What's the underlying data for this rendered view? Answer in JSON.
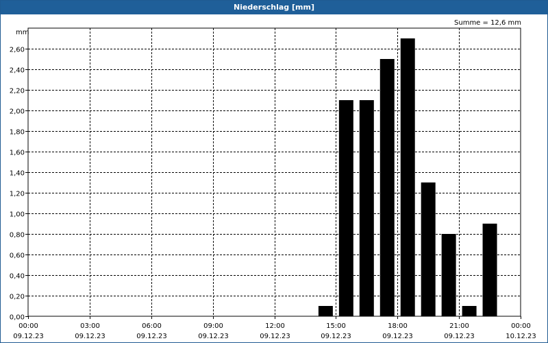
{
  "title": "Niederschlag [mm]",
  "summary": "Summe = 12,6 mm",
  "chart_data": {
    "type": "bar",
    "title": "Niederschlag [mm]",
    "ylabel": "mm",
    "ylim": [
      0,
      2.8
    ],
    "yticks": [
      "0,00",
      "0,20",
      "0,40",
      "0,60",
      "0,80",
      "1,00",
      "1,20",
      "1,40",
      "1,60",
      "1,80",
      "2,00",
      "2,20",
      "2,40",
      "2,60"
    ],
    "x_range_hours": [
      0,
      24
    ],
    "x_ticks": [
      {
        "hour": 0,
        "time": "00:00",
        "date": "09.12.23"
      },
      {
        "hour": 3,
        "time": "03:00",
        "date": "09.12.23"
      },
      {
        "hour": 6,
        "time": "06:00",
        "date": "09.12.23"
      },
      {
        "hour": 9,
        "time": "09:00",
        "date": "09.12.23"
      },
      {
        "hour": 12,
        "time": "12:00",
        "date": "09.12.23"
      },
      {
        "hour": 15,
        "time": "15:00",
        "date": "09.12.23"
      },
      {
        "hour": 18,
        "time": "18:00",
        "date": "09.12.23"
      },
      {
        "hour": 21,
        "time": "21:00",
        "date": "09.12.23"
      },
      {
        "hour": 24,
        "time": "00:00",
        "date": "10.12.23"
      }
    ],
    "bars": [
      {
        "hour": 14,
        "value": 0.1
      },
      {
        "hour": 15,
        "value": 2.1
      },
      {
        "hour": 16,
        "value": 2.1
      },
      {
        "hour": 17,
        "value": 2.5
      },
      {
        "hour": 18,
        "value": 2.7
      },
      {
        "hour": 19,
        "value": 1.3
      },
      {
        "hour": 20,
        "value": 0.8
      },
      {
        "hour": 21,
        "value": 0.1
      },
      {
        "hour": 22,
        "value": 0.9
      }
    ],
    "grid": true,
    "bar_color": "#000000"
  },
  "colors": {
    "titlebar": "#1f5f99",
    "border": "#1f5a92"
  }
}
